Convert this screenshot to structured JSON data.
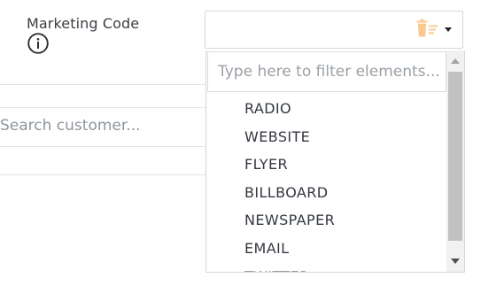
{
  "marketing_code": {
    "label": "Marketing Code",
    "info_icon": "info-circle-icon",
    "select": {
      "selected_value": "",
      "clear_icon": "trash-clear-icon",
      "toggle_icon": "caret-down-icon",
      "accent_color": "#f9c98d"
    },
    "dropdown": {
      "filter_placeholder": "Type here to filter elements...",
      "filter_value": "",
      "options": [
        "RADIO",
        "WEBSITE",
        "FLYER",
        "BILLBOARD",
        "NEWSPAPER",
        "EMAIL",
        "TWITTER"
      ]
    }
  },
  "customer_search": {
    "placeholder": "Search customer..."
  }
}
